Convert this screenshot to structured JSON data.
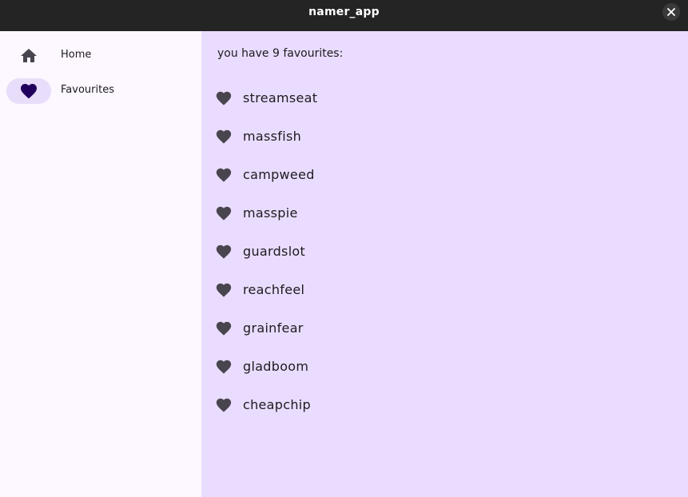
{
  "window": {
    "title": "namer_app"
  },
  "colors": {
    "titlebar": "#242424",
    "rail_background": "#fdf7ff",
    "main_background": "#eadcfe",
    "selected_indicator": "#e8ddfa",
    "icon": "#49454f",
    "selected_icon": "#21005d"
  },
  "rail": {
    "items": [
      {
        "label": "Home",
        "icon": "home-icon",
        "selected": false
      },
      {
        "label": "Favourites",
        "icon": "heart-icon",
        "selected": true
      }
    ]
  },
  "favourites": {
    "count_text": "you have 9 favourites:",
    "items": [
      {
        "word": "streamseat",
        "icon": "heart-icon"
      },
      {
        "word": "massfish",
        "icon": "heart-icon"
      },
      {
        "word": "campweed",
        "icon": "heart-icon"
      },
      {
        "word": "masspie",
        "icon": "heart-icon"
      },
      {
        "word": "guardslot",
        "icon": "heart-icon"
      },
      {
        "word": "reachfeel",
        "icon": "heart-icon"
      },
      {
        "word": "grainfear",
        "icon": "heart-icon"
      },
      {
        "word": "gladboom",
        "icon": "heart-icon"
      },
      {
        "word": "cheapchip",
        "icon": "heart-icon"
      }
    ]
  }
}
